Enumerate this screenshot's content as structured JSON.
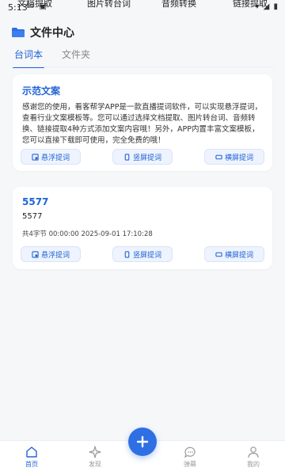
{
  "status_bar": {
    "time": "5:13",
    "left_icons": "✉ ▣",
    "right_icons": "▾ ◢ ▮"
  },
  "top_strip": [
    "文档提取",
    "图片转台词",
    "音频转换",
    "链接提取"
  ],
  "header": {
    "title": "文件中心"
  },
  "tabs": [
    {
      "label": "台词本",
      "active": true
    },
    {
      "label": "文件夹",
      "active": false
    }
  ],
  "cards": [
    {
      "title": "示范文案",
      "body": "感谢您的使用，看客帮学APP是一款直播提词软件，可以实现悬浮提词，查看行业文案模板等。您可以通过选择文档提取、图片转台词、音频转换、链接提取4种方式添加文案内容哦！另外，APP内置丰富文案模板，您可以直接下载即可使用，完全免费的哦！",
      "buttons": [
        "悬浮提词",
        "竖屏提词",
        "横屏提词"
      ]
    },
    {
      "title": "5577",
      "body": "5577",
      "meta": "共4字节 00:00:00  2025-09-01 17:10:28",
      "buttons": [
        "悬浮提词",
        "竖屏提词",
        "横屏提词"
      ]
    }
  ],
  "bottom_nav": [
    {
      "label": "首页",
      "icon": "home-icon",
      "active": true
    },
    {
      "label": "发现",
      "icon": "sparkle-icon",
      "active": false
    },
    {
      "label": "弹幕",
      "icon": "chat-icon",
      "active": false
    },
    {
      "label": "我的",
      "icon": "user-icon",
      "active": false
    }
  ],
  "colors": {
    "accent": "#1f63d6",
    "fab": "#2f6fe4",
    "background": "#f6f7f9"
  }
}
